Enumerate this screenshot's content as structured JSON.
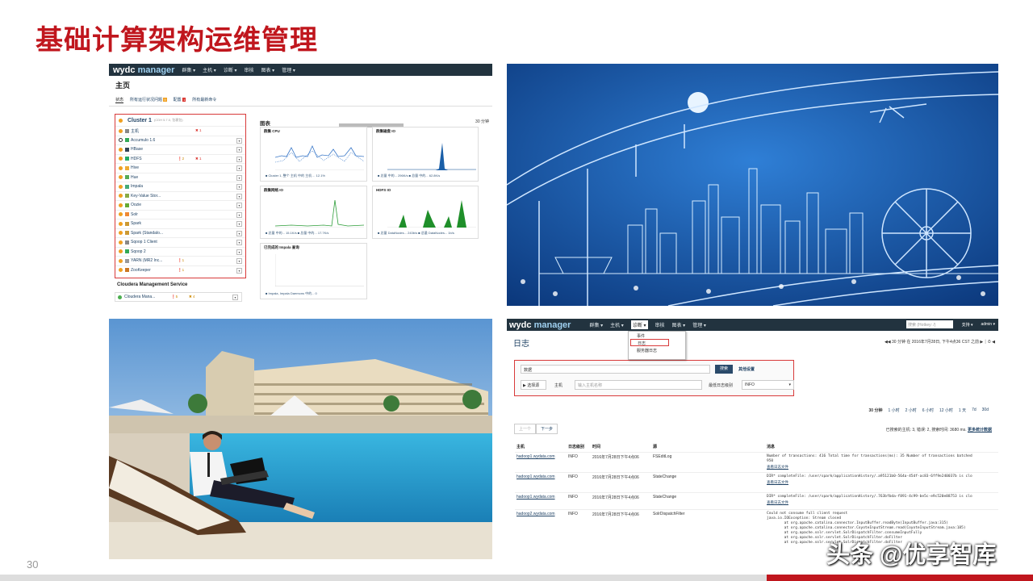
{
  "slide": {
    "title": "基础计算架构运维管理",
    "page_number": "30",
    "watermark": "头条 @优享智库",
    "accent_color": "#c0161d"
  },
  "cm_home": {
    "logo_main": "wydc",
    "logo_sub": "manager",
    "nav": [
      "群集 ▾",
      "主机 ▾",
      "诊断 ▾",
      "审核",
      "图表 ▾",
      "管理 ▾"
    ],
    "page_title": "主页",
    "tabs": [
      "状态",
      "所有运行状况问题",
      "配置",
      "所有最新命令"
    ],
    "tab_badges": [
      "9",
      "1"
    ],
    "cluster": {
      "name": "Cluster 1",
      "version": "(CDH 5.7.0, 包裹包)",
      "services": [
        {
          "name": "主机",
          "b1": "",
          "b2": "✖ 1"
        },
        {
          "name": "Accumulo 1.6",
          "b1": "",
          "b2": ""
        },
        {
          "name": "HBase",
          "b1": "",
          "b2": ""
        },
        {
          "name": "HDFS",
          "b1": "❗2",
          "b2": "✖ 1"
        },
        {
          "name": "Hive",
          "b1": "",
          "b2": ""
        },
        {
          "name": "Hue",
          "b1": "",
          "b2": ""
        },
        {
          "name": "Impala",
          "b1": "",
          "b2": ""
        },
        {
          "name": "Key-Value Stor...",
          "b1": "",
          "b2": ""
        },
        {
          "name": "Oozie",
          "b1": "",
          "b2": ""
        },
        {
          "name": "Solr",
          "b1": "",
          "b2": ""
        },
        {
          "name": "Spark",
          "b1": "",
          "b2": ""
        },
        {
          "name": "Spark (Standalo...",
          "b1": "",
          "b2": ""
        },
        {
          "name": "Sqoop 1 Client",
          "b1": "",
          "b2": ""
        },
        {
          "name": "Sqoop 2",
          "b1": "",
          "b2": ""
        },
        {
          "name": "YARN (MR2 Inc...",
          "b1": "❗1",
          "b2": ""
        },
        {
          "name": "ZooKeeper",
          "b1": "❗1",
          "b2": ""
        }
      ]
    },
    "mgmt_title": "Cloudera Management Service",
    "mgmt_service": "Cloudera Mana...",
    "mgmt_badges": [
      "❗5",
      "✖ 4"
    ],
    "charts_title": "图表",
    "charts_range": "30 分钟",
    "charts": [
      {
        "title": "群集 CPU",
        "legend": "■ Cluster 1, 整个 主机 中的 主机 ... 12.1%",
        "ytick_top": "100%",
        "ytick_mid": "50%",
        "xtick": "03:30"
      },
      {
        "title": "群集磁盘 IO",
        "legend": "■ 总量 中的... 296K/s ■ 总量 中的... 62.8K/s",
        "ytick_top": "381M/s",
        "ytick_mid": "191M/s",
        "xtick": "03:30"
      },
      {
        "title": "群集网络 IO",
        "legend": "■ 总量 中的... 15.1K/s ■ 总量 中的... 17.7K/s",
        "ytick_top": "28.6M/s",
        "ytick_mid": "19.1M/s",
        "xtick": "03:30"
      },
      {
        "title": "HDFS IO",
        "legend": "■ 总量 DataNodes... 243b/s ■ 总量 DataNodes... 1b/s",
        "ytick_top": "",
        "ytick_mid": "",
        "xtick": ""
      },
      {
        "title": "已完成的 Impala 查询",
        "legend": "■ Impala, Impala Daemons 中的... 0",
        "ytick_top": "",
        "ytick_mid": "",
        "xtick": ""
      }
    ]
  },
  "log_page": {
    "logo_main": "wydc",
    "logo_sub": "manager",
    "nav": [
      "群集 ▾",
      "主机 ▾",
      "诊断 ▾",
      "审核",
      "图表 ▾",
      "管理 ▾"
    ],
    "search_placeholder": "搜索 (Hotkey: /)",
    "support": "支持 ▾",
    "user": "admin ▾",
    "diag_menu": [
      "事件",
      "日志",
      "服务器日志"
    ],
    "page_title": "日志",
    "time_nav": "◀◀ 30 分钟 在 2016年7月28日, 下午4点36 CST 之前 ▶ ⏐ ⏱ ◀",
    "search_value": "数据",
    "search_button": "搜索",
    "other_settings": "其他设置",
    "select_sources": "▶ 选择源",
    "host_label": "主机",
    "host_placeholder": "输入主机名称",
    "min_level_label": "最低日志级别",
    "min_level": "INFO",
    "ranges": [
      "30 分钟",
      "1 小时",
      "2 小时",
      "6 小时",
      "12 小时",
      "1 天",
      "7d",
      "30d"
    ],
    "prev": "上一个",
    "next": "下一步",
    "results_text": "已搜索的主机: 3, 错误: 2, 搜索时间: 3680 ms.",
    "results_link": "更多统计数据",
    "columns": [
      "主机",
      "日志级别",
      "时间",
      "源",
      "消息"
    ],
    "rows": [
      {
        "host": "hadoop1.wydata.com",
        "level": "INFO",
        "time": "2016年7月28日下午4点06",
        "source": "FSEditLog",
        "message": "Number of transactions: 416 Total time for transactions(ms): 35 Number of transactions batched\n950",
        "link": "查看日志文件"
      },
      {
        "host": "hadoop1.wydata.com",
        "level": "INFO",
        "time": "2016年7月28日下午4点06",
        "source": "StateChange",
        "message": "DIR* completeFile: /user/spark/applicationHistory/.a95121b0-564a-45df-ac83-6ff9e240037b is clo",
        "link": "查看日志文件"
      },
      {
        "host": "hadoop1.wydata.com",
        "level": "INFO",
        "time": "2016年7月28日下午4点06",
        "source": "StateChange",
        "message": "DIR* completeFile: /user/spark/applicationHistory/.763bfbda-f891-4c99-be5c-e9c520e88753 is clo",
        "link": "查看日志文件"
      },
      {
        "host": "hadoop2.wydata.com",
        "level": "INFO",
        "time": "2016年7月28日下午4点06",
        "source": "SolrDispatchFilter",
        "message": "Could not consume full client request\njava.io.IOException: Stream closed\n        at org.apache.catalina.connector.InputBuffer.readByte(InputBuffer.java:315)\n        at org.apache.catalina.connector.CoyoteInputStream.read(CoyoteInputStream.java:185)\n        at org.apache.solr.servlet.SolrDispatchFilter.consumeInputFully\n        at org.apache.solr.servlet.SolrDispatchFilter.doFilter\n        at org.apache.solr.servlet.SolrDispatchFilter.doFilter",
        "link": ""
      }
    ]
  }
}
